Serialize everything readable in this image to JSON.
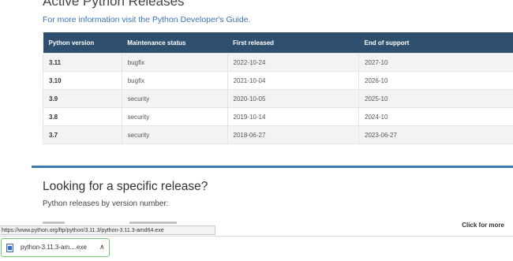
{
  "page": {
    "heading": "Active Python Releases",
    "info_text": "For more information visit the Python Developer's Guide.",
    "accent_color": "#3e78b5"
  },
  "releases_table": {
    "headers": [
      "Python version",
      "Maintenance status",
      "First released",
      "End of support"
    ],
    "rows": [
      [
        "3.11",
        "bugfix",
        "2022-10-24",
        "2027-10"
      ],
      [
        "3.10",
        "bugfix",
        "2021-10-04",
        "2026-10"
      ],
      [
        "3.9",
        "security",
        "2020-10-05",
        "2025-10"
      ],
      [
        "3.8",
        "security",
        "2019-10-14",
        "2024-10"
      ],
      [
        "3.7",
        "security",
        "2018-06-27",
        "2023-06-27"
      ]
    ],
    "header_color": "#2f4f6f"
  },
  "specific_release": {
    "title": "Looking for a specific release?",
    "subtitle": "Python releases by version number:",
    "click_more": "Click for more"
  },
  "status_bar": {
    "url": "https://www.python.org/ftp/python/3.11.3/python-3.11.3-amd64.exe"
  },
  "downloads": {
    "item_label": "python-3.11.3-am....exe",
    "item_icon": "file-icon",
    "menu_icon": "chevron-up-icon",
    "border_color": "#73c673"
  }
}
